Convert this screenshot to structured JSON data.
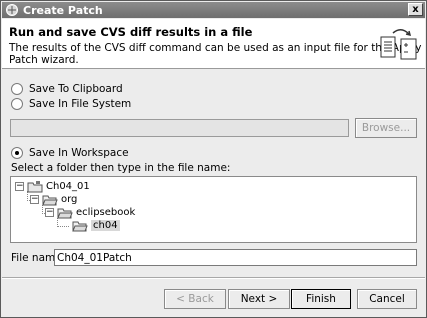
{
  "window": {
    "title": "Create Patch",
    "close_label": "x"
  },
  "header": {
    "title": "Run and save CVS diff results in a file",
    "description": "The results of the CVS diff command can be used as an input file for the Apply Patch wizard."
  },
  "options": {
    "clipboard": "Save To Clipboard",
    "filesystem": "Save In File System",
    "browse": "Browse...",
    "workspace": "Save In Workspace",
    "selected": "workspace"
  },
  "folder_prompt": "Select a folder then type in the file name:",
  "tree": {
    "items": [
      {
        "label": "Ch04_01",
        "expander": "−"
      },
      {
        "label": "org",
        "expander": "−"
      },
      {
        "label": "eclipsebook",
        "expander": "−"
      },
      {
        "label": "ch04",
        "expander": ""
      }
    ],
    "selected": "ch04"
  },
  "file": {
    "label": "File name:",
    "value": "Ch04_01Patch"
  },
  "buttons": {
    "back": "< Back",
    "next": "Next >",
    "finish": "Finish",
    "cancel": "Cancel"
  }
}
